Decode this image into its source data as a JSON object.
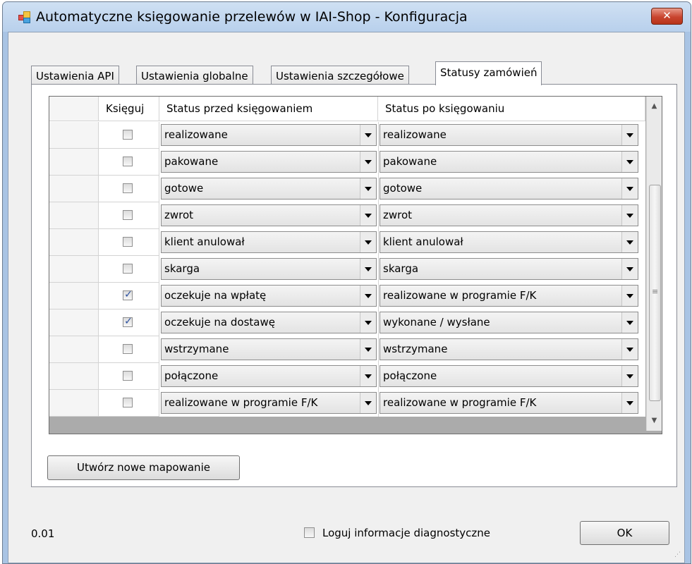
{
  "window": {
    "title": "Automatyczne księgowanie przelewów w IAI-Shop - Konfiguracja",
    "close_label": "✕",
    "app_icon": "app-icon",
    "accent_color": "#c9452f"
  },
  "tabs": [
    {
      "label": "Ustawienia API"
    },
    {
      "label": "Ustawienia globalne"
    },
    {
      "label": "Ustawienia szczegółowe"
    },
    {
      "label": "Statusy zamówień"
    }
  ],
  "active_tab": "Statusy zamówień",
  "grid": {
    "columns": [
      "Księguj",
      "Status przed księgowaniem",
      "Status po księgowaniu"
    ],
    "rows": [
      {
        "checked": false,
        "before": "realizowane",
        "after": "realizowane"
      },
      {
        "checked": false,
        "before": "pakowane",
        "after": "pakowane"
      },
      {
        "checked": false,
        "before": "gotowe",
        "after": "gotowe"
      },
      {
        "checked": false,
        "before": "zwrot",
        "after": "zwrot"
      },
      {
        "checked": false,
        "before": "klient anulował",
        "after": "klient anulował"
      },
      {
        "checked": false,
        "before": "skarga",
        "after": "skarga"
      },
      {
        "checked": true,
        "before": "oczekuje na wpłatę",
        "after": "realizowane w programie F/K"
      },
      {
        "checked": true,
        "before": "oczekuje na dostawę",
        "after": "wykonane / wysłane"
      },
      {
        "checked": false,
        "before": "wstrzymane",
        "after": "wstrzymane"
      },
      {
        "checked": false,
        "before": "połączone",
        "after": "połączone"
      },
      {
        "checked": false,
        "before": "realizowane w programie F/K",
        "after": "realizowane w programie F/K"
      }
    ]
  },
  "buttons": {
    "new_mapping": "Utwórz nowe mapowanie",
    "ok": "OK"
  },
  "footer": {
    "version": "0.01",
    "log_label": "Loguj informacje diagnostyczne",
    "log_checked": false
  }
}
